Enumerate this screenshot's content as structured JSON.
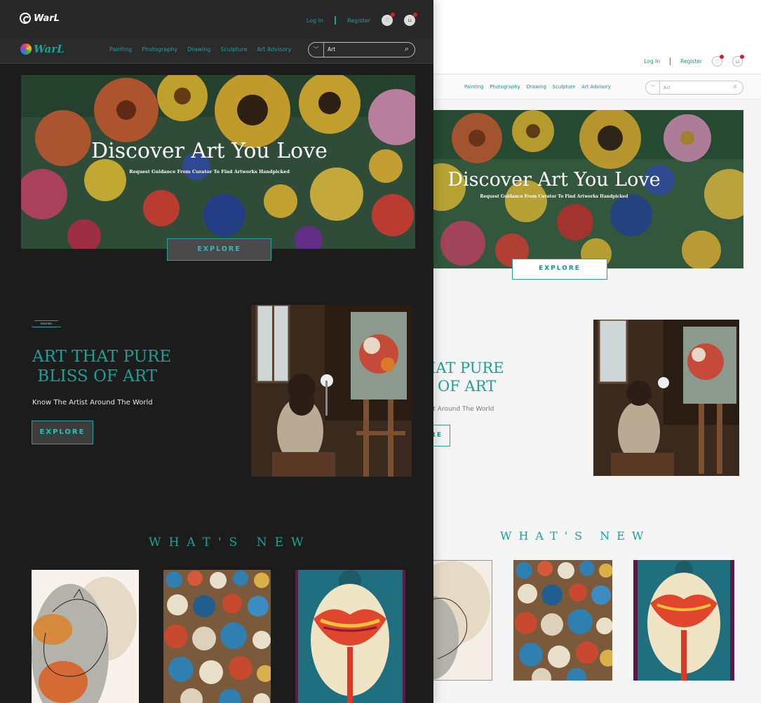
{
  "brand": {
    "name": "WarL"
  },
  "header": {
    "login": "Log In",
    "register": "Register",
    "wishlist_icon": "heart-icon",
    "cart_icon": "cart-icon"
  },
  "nav": {
    "items": [
      "Painting",
      "Photography",
      "Drawing",
      "Sculpture",
      "Art Advisory"
    ]
  },
  "search": {
    "dark_value": "Art",
    "light_value": "Art"
  },
  "hero": {
    "title": "Discover Art You Love",
    "subtitle": "Request Guidance From Curator To Find Artworks Handpicked",
    "button": "EXPLORE"
  },
  "feature": {
    "tag": "PAINTING",
    "title_line1": "ART THAT PURE",
    "title_line2": " BLISS OF ART",
    "subtitle": "Know The Artist Around The World",
    "button": "EXPLORE"
  },
  "light_partial": {
    "title_line1": "HAT PURE",
    "title_line2": "S OF ART",
    "subtitle": "rtist Around The World",
    "button": "RE"
  },
  "whats_new": {
    "title": "WHAT'S NEW"
  },
  "colors": {
    "accent": "#1aa196",
    "dark_bg": "#1c1c1c",
    "light_bg": "#f5f5f5",
    "badge": "#d81f26"
  }
}
